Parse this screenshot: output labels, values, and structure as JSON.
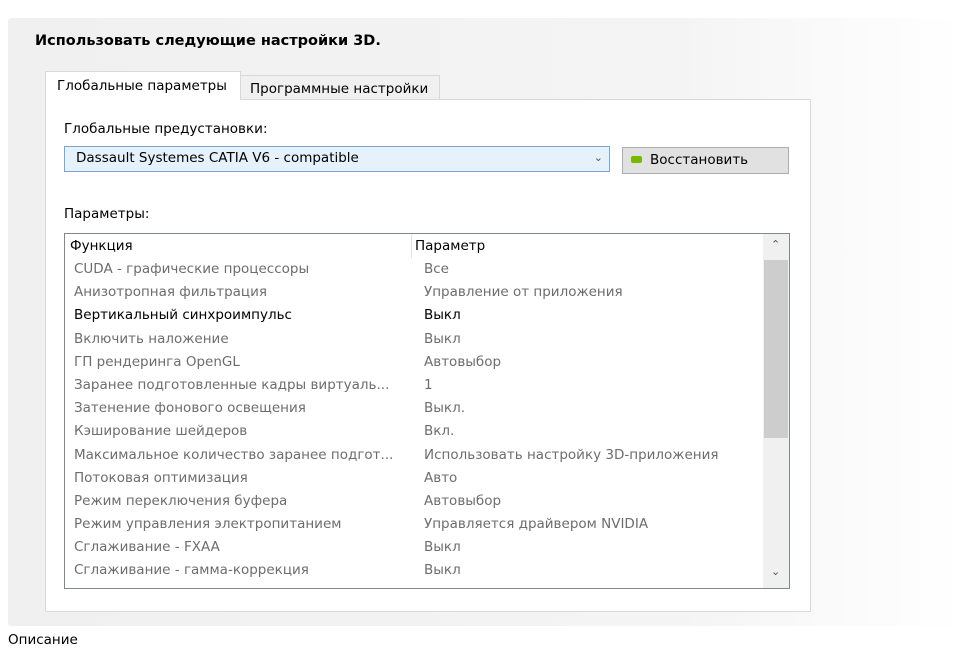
{
  "section_title": "Использовать следующие настройки 3D.",
  "tabs": [
    {
      "label": "Глобальные параметры",
      "active": true
    },
    {
      "label": "Программные настройки",
      "active": false
    }
  ],
  "presets": {
    "label": "Глобальные предустановки:",
    "selected": "Dassault Systemes CATIA V6 - compatible",
    "restore_label": "Восстановить"
  },
  "params": {
    "label": "Параметры:",
    "columns": [
      "Функция",
      "Параметр"
    ],
    "rows": [
      {
        "feature": "CUDA - графические процессоры",
        "value": "Все",
        "active": false
      },
      {
        "feature": "Анизотропная фильтрация",
        "value": "Управление от приложения",
        "active": false
      },
      {
        "feature": "Вертикальный синхроимпульс",
        "value": "Выкл",
        "active": true
      },
      {
        "feature": "Включить наложение",
        "value": "Выкл",
        "active": false
      },
      {
        "feature": "ГП рендеринга OpenGL",
        "value": "Автовыбор",
        "active": false
      },
      {
        "feature": "Заранее подготовленные кадры виртуаль...",
        "value": "1",
        "active": false
      },
      {
        "feature": "Затенение фонового освещения",
        "value": "Выкл.",
        "active": false
      },
      {
        "feature": "Кэширование шейдеров",
        "value": "Вкл.",
        "active": false
      },
      {
        "feature": "Максимальное количество заранее подгот...",
        "value": "Использовать настройку 3D-приложения",
        "active": false
      },
      {
        "feature": "Потоковая оптимизация",
        "value": "Авто",
        "active": false
      },
      {
        "feature": "Режим переключения буфера",
        "value": "Автовыбор",
        "active": false
      },
      {
        "feature": "Режим управления электропитанием",
        "value": "Управляется драйвером NVIDIA",
        "active": false
      },
      {
        "feature": "Сглаживание - FXAA",
        "value": "Выкл",
        "active": false
      },
      {
        "feature": "Сглаживание - гамма-коррекция",
        "value": "Выкл",
        "active": false
      }
    ]
  },
  "description_label": "Описание",
  "icons": {
    "restore": "nvidia-icon",
    "dropdown": "chevron-down-icon",
    "scroll_up": "chevron-up-icon",
    "scroll_down": "chevron-down-icon"
  },
  "colors": {
    "nvidia_green": "#76b900",
    "select_bg": "#e5f1fb",
    "select_border": "#7aa7d1",
    "inactive_text": "#6d6d6d"
  }
}
